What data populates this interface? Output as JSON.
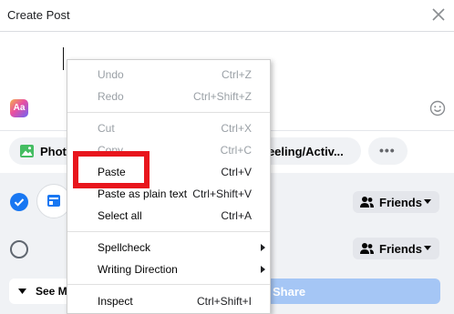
{
  "dialog": {
    "title": "Create Post",
    "close_icon": "close-icon"
  },
  "composer": {
    "text_format_icon": "text-format-aa-icon",
    "text_format_label": "Aa",
    "emoji_icon": "emoji-icon"
  },
  "toolbar": {
    "photo_label": "Photo",
    "photo_icon": "photo-icon",
    "feeling_label": "Feeling/Activ...",
    "more_label": "•••"
  },
  "destinations": [
    {
      "selected": true,
      "privacy_label": "Friends"
    },
    {
      "selected": false,
      "privacy_label": "Friends"
    }
  ],
  "footer": {
    "see_more_label": "See M",
    "share_label": "Share"
  },
  "context_menu": {
    "groups": [
      [
        {
          "label": "Undo",
          "shortcut": "Ctrl+Z",
          "disabled": true
        },
        {
          "label": "Redo",
          "shortcut": "Ctrl+Shift+Z",
          "disabled": true
        }
      ],
      [
        {
          "label": "Cut",
          "shortcut": "Ctrl+X",
          "disabled": true
        },
        {
          "label": "Copy",
          "shortcut": "Ctrl+C",
          "disabled": true
        },
        {
          "label": "Paste",
          "shortcut": "Ctrl+V",
          "disabled": false
        },
        {
          "label": "Paste as plain text",
          "shortcut": "Ctrl+Shift+V",
          "disabled": false
        },
        {
          "label": "Select all",
          "shortcut": "Ctrl+A",
          "disabled": false
        }
      ],
      [
        {
          "label": "Spellcheck",
          "submenu": true
        },
        {
          "label": "Writing Direction",
          "submenu": true
        }
      ],
      [
        {
          "label": "Inspect",
          "shortcut": "Ctrl+Shift+I",
          "disabled": false
        }
      ]
    ],
    "highlighted_item": "Paste",
    "highlight_color": "#e8161d"
  },
  "colors": {
    "accent": "#1877f2",
    "share_disabled": "#a5c6f5"
  }
}
